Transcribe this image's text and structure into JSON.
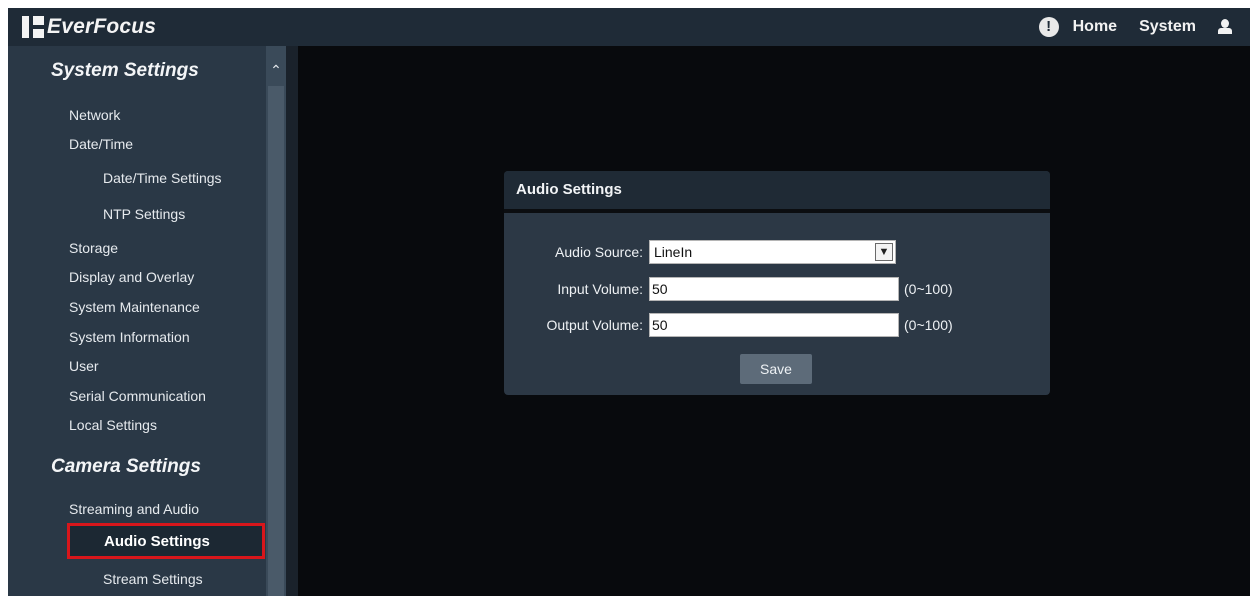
{
  "topbar": {
    "logo_text": "EverFocus",
    "info_icon": "!",
    "home_label": "Home",
    "system_label": "System"
  },
  "sidebar": {
    "system_settings_title": "System Settings",
    "items": [
      {
        "label": "Network"
      },
      {
        "label": "Date/Time"
      },
      {
        "label": "Date/Time Settings"
      },
      {
        "label": "NTP Settings"
      },
      {
        "label": "Storage"
      },
      {
        "label": "Display and Overlay"
      },
      {
        "label": "System Maintenance"
      },
      {
        "label": "System Information"
      },
      {
        "label": "User"
      },
      {
        "label": "Serial Communication"
      },
      {
        "label": "Local Settings"
      }
    ],
    "camera_settings_title": "Camera Settings",
    "camera_items": [
      {
        "label": "Streaming and Audio"
      },
      {
        "label": "Audio Settings"
      },
      {
        "label": "Stream Settings"
      }
    ]
  },
  "panel": {
    "title": "Audio Settings",
    "audio_source_label": "Audio Source:",
    "audio_source_value": "LineIn",
    "input_volume_label": "Input Volume:",
    "input_volume_value": "50",
    "input_volume_range": "(0~100)",
    "output_volume_label": "Output Volume:",
    "output_volume_value": "50",
    "output_volume_range": "(0~100)",
    "save_label": "Save"
  },
  "colors": {
    "topbar": "#1f2b37",
    "sidebar": "#2a3846",
    "highlight": "#d8161b",
    "panel": "#2c3845"
  }
}
